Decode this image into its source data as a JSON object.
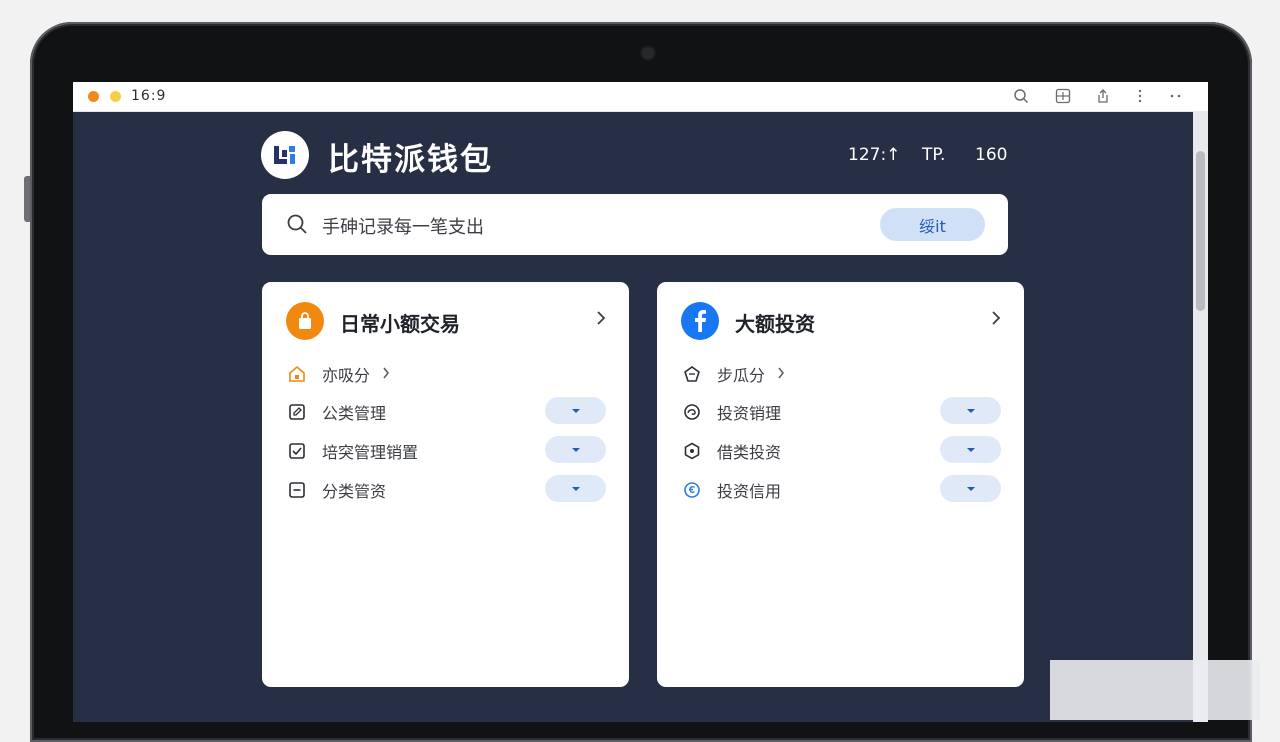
{
  "window": {
    "title": "16:9",
    "toolbar_icons": [
      "search-icon",
      "layout-icon",
      "share-icon",
      "more-vertical-icon",
      "more-horizontal-icon"
    ]
  },
  "header": {
    "app_name": "比特派钱包",
    "logo_icon": "wallet-logo-icon",
    "stats": [
      "127:↑",
      "TP.",
      "160"
    ]
  },
  "search": {
    "placeholder_text": "手砷记录每一笔支出",
    "button_label": "绥it"
  },
  "cards": [
    {
      "title": "日常小额交易",
      "icon": "bag-icon",
      "icon_color": "#f0890f",
      "items": [
        {
          "label": "亦吸分",
          "icon": "home-icon",
          "has_chevron": true,
          "has_dropdown": false
        },
        {
          "label": "公类管理",
          "icon": "edit-square-icon",
          "has_chevron": false,
          "has_dropdown": true
        },
        {
          "label": "培突管理销置",
          "icon": "checkbox-icon",
          "has_chevron": false,
          "has_dropdown": true
        },
        {
          "label": "分类管资",
          "icon": "minus-square-icon",
          "has_chevron": false,
          "has_dropdown": true
        }
      ]
    },
    {
      "title": "大额投资",
      "icon": "facebook-icon",
      "icon_color": "#1877f2",
      "items": [
        {
          "label": "步瓜分",
          "icon": "pentagon-icon",
          "has_chevron": true,
          "has_dropdown": false
        },
        {
          "label": "投资销理",
          "icon": "swirl-icon",
          "has_chevron": false,
          "has_dropdown": true
        },
        {
          "label": "借类投资",
          "icon": "hexagon-icon",
          "has_chevron": false,
          "has_dropdown": true
        },
        {
          "label": "投资信用",
          "icon": "coin-icon",
          "has_chevron": false,
          "has_dropdown": true
        }
      ]
    }
  ],
  "colors": {
    "screen_bg": "#262f44",
    "accent_blue": "#1e5fb5",
    "pill_bg": "#dfe9f7",
    "orange": "#f0890f"
  }
}
